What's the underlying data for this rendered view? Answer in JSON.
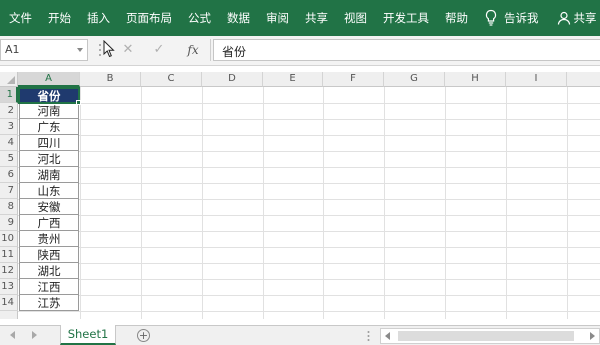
{
  "ribbon": {
    "tabs": [
      "文件",
      "开始",
      "插入",
      "页面布局",
      "公式",
      "数据",
      "审阅",
      "共享",
      "视图",
      "开发工具",
      "帮助"
    ],
    "tell_me": "告诉我",
    "share": "共享",
    "color": "#217346"
  },
  "formula_bar": {
    "name_box": "A1",
    "cancel": "✕",
    "enter": "✓",
    "fx": "fx",
    "content": "省份"
  },
  "columns": [
    "A",
    "B",
    "C",
    "D",
    "E",
    "F",
    "G",
    "H",
    "I"
  ],
  "rows": [
    "1",
    "2",
    "3",
    "4",
    "5",
    "6",
    "7",
    "8",
    "9",
    "10",
    "11",
    "12",
    "13",
    "14"
  ],
  "cells_a": [
    "省份",
    "河南",
    "广东",
    "四川",
    "河北",
    "湖南",
    "山东",
    "安徽",
    "广西",
    "贵州",
    "陕西",
    "湖北",
    "江西",
    "江苏"
  ],
  "sheets": {
    "tab": "Sheet1",
    "add": "+"
  },
  "header_fill": "#1f3a6e"
}
